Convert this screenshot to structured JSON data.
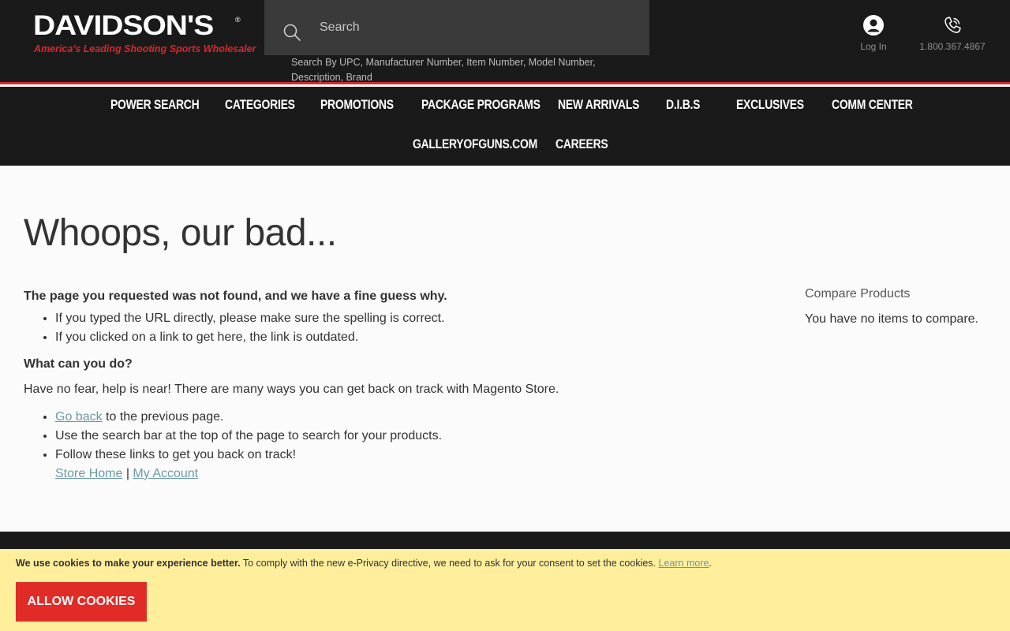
{
  "header": {
    "logo": {
      "wordmark": "DAVIDSON'S",
      "tagline": "America's Leading Shooting Sports Wholesaler"
    },
    "search": {
      "placeholder": "Search",
      "hint": "Search By UPC, Manufacturer Number, Item Number, Model Number, Description, Brand"
    },
    "login_label": "Log In",
    "phone_label": "1.800.367.4867"
  },
  "nav": {
    "items": [
      {
        "label": "Power Search"
      },
      {
        "label": "Categories"
      },
      {
        "label": "Promotions"
      },
      {
        "label": "Package Programs"
      },
      {
        "label": "New Arrivals"
      },
      {
        "label": "D.I.B.S"
      },
      {
        "label": "Exclusives"
      },
      {
        "label": "Comm Center"
      },
      {
        "label": "GalleryofGuns.com"
      },
      {
        "label": "Careers"
      }
    ]
  },
  "main": {
    "title": "Whoops, our bad...",
    "lead": "The page you requested was not found, and we have a fine guess why.",
    "reasons": [
      "If you typed the URL directly, please make sure the spelling is correct.",
      "If you clicked on a link to get here, the link is outdated."
    ],
    "question": "What can you do?",
    "help": "Have no fear, help is near! There are many ways you can get back on track with Magento Store.",
    "go_back_link": "Go back",
    "go_back_rest": " to the previous page.",
    "search_tip": "Use the search bar at the top of the page to search for your products.",
    "follow_tip": "Follow these links to get you back on track!",
    "store_home_link": "Store Home",
    "separator": " | ",
    "my_account_link": "My Account"
  },
  "sidebar": {
    "compare_title": "Compare Products",
    "compare_empty": "You have no items to compare."
  },
  "cookie": {
    "bold_text": "We use cookies to make your experience better.",
    "text": " To comply with the new e-Privacy directive, we need to ask for your consent to set the cookies. ",
    "learn_more": "Learn more",
    "period": ".",
    "button_label": "Allow Cookies"
  },
  "colors": {
    "header_bg": "#1a1a1a",
    "accent_red": "#d9272e",
    "link": "#6a9aa3",
    "cookie_bg": "#ffee9c",
    "button_red": "#e02b27"
  }
}
